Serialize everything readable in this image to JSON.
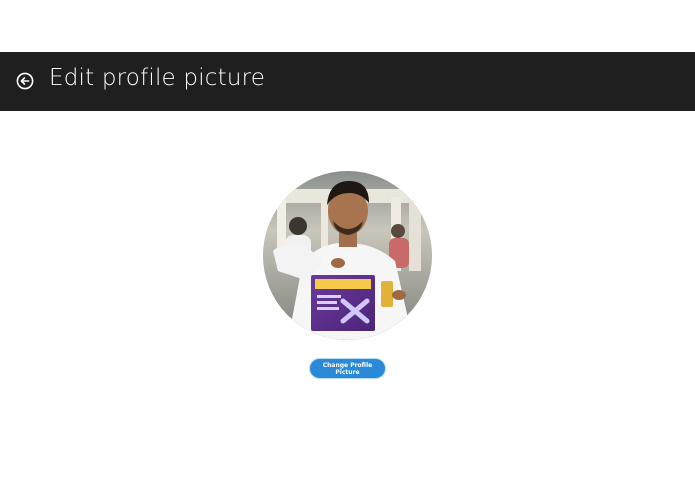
{
  "header": {
    "title": "Edit profile picture",
    "back_icon": "back-arrow-circle-icon"
  },
  "profile": {
    "avatar_alt": "Profile photo"
  },
  "actions": {
    "change_label": "Change Profile Picture"
  },
  "colors": {
    "header_bg": "#1f1f1f",
    "button_bg": "#2a8ad8",
    "page_bg": "#ffffff"
  }
}
